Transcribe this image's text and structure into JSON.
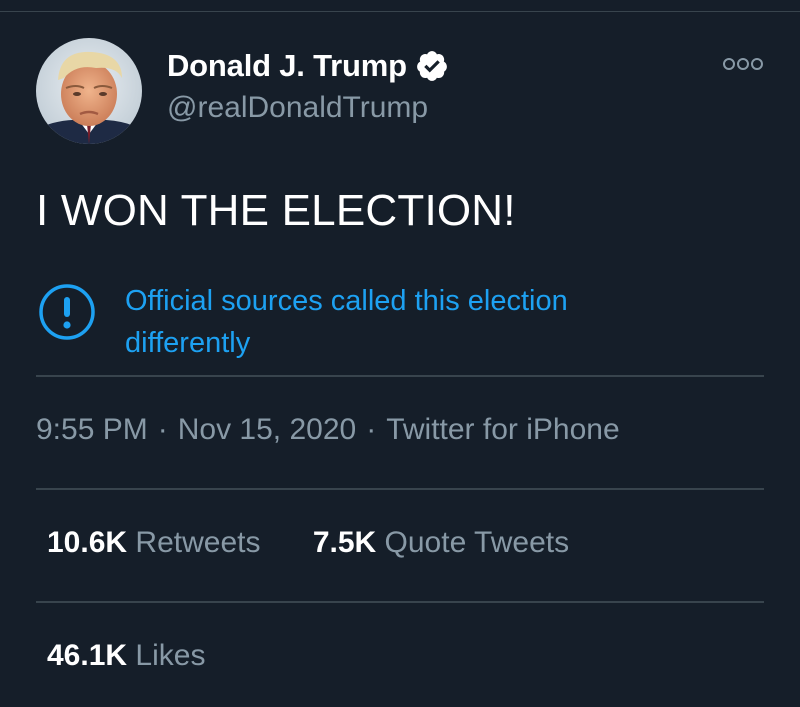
{
  "user": {
    "display_name": "Donald J. Trump",
    "handle": "@realDonaldTrump",
    "verified": true
  },
  "tweet": {
    "text": "I WON THE ELECTION!",
    "notice": "Official sources called this election differently",
    "time": "9:55 PM",
    "date": "Nov 15, 2020",
    "source": "Twitter for iPhone",
    "separator": "·"
  },
  "stats": {
    "retweets": {
      "count": "10.6K",
      "label": "Retweets"
    },
    "quote_tweets": {
      "count": "7.5K",
      "label": "Quote Tweets"
    },
    "likes": {
      "count": "46.1K",
      "label": "Likes"
    }
  },
  "icons": {
    "verified": "verified-badge-icon",
    "more": "more-options-icon",
    "notice": "exclamation-circle-icon"
  },
  "colors": {
    "background": "#151e29",
    "accent": "#1da1f2",
    "muted_text": "#8899a6",
    "divider": "#38444d"
  }
}
